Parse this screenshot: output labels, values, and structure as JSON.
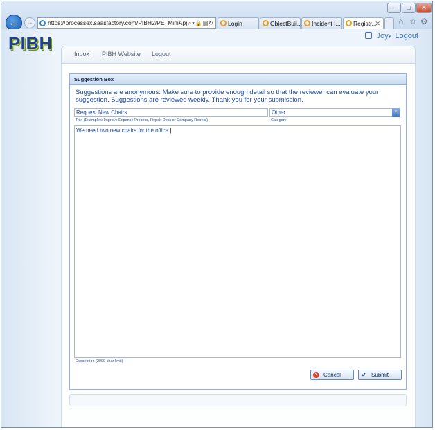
{
  "browser": {
    "address": "https://processex.saasfactory.com/PIBH2/PE_MiniApp_C",
    "tabs": [
      {
        "label": "Login"
      },
      {
        "label": "ObjectBuil..."
      },
      {
        "label": "Incident I..."
      },
      {
        "label": "Registr..."
      }
    ]
  },
  "app": {
    "logo": "PIBH",
    "user": "Joy",
    "logout": "Logout",
    "nav": [
      "Inbox",
      "PIBH Website",
      "Logout"
    ]
  },
  "form": {
    "panel_title": "Suggestion Box",
    "intro": "Suggestions are anonymous. Make sure to provide enough detail so that the reviewer can evaluate your suggestion. Suggestions are reviewed weekly. Thank you for your submission.",
    "title_value": "Request New Chairs",
    "title_label": "Title (Examples: Improve Expense Process, Repair Desk or Company Retreat)",
    "category_value": "Other",
    "category_label": "Category",
    "description_value": "We need two new chairs for the office.",
    "description_label": "Description (2000 char limit)",
    "cancel_label": "Cancel",
    "submit_label": "Submit"
  }
}
